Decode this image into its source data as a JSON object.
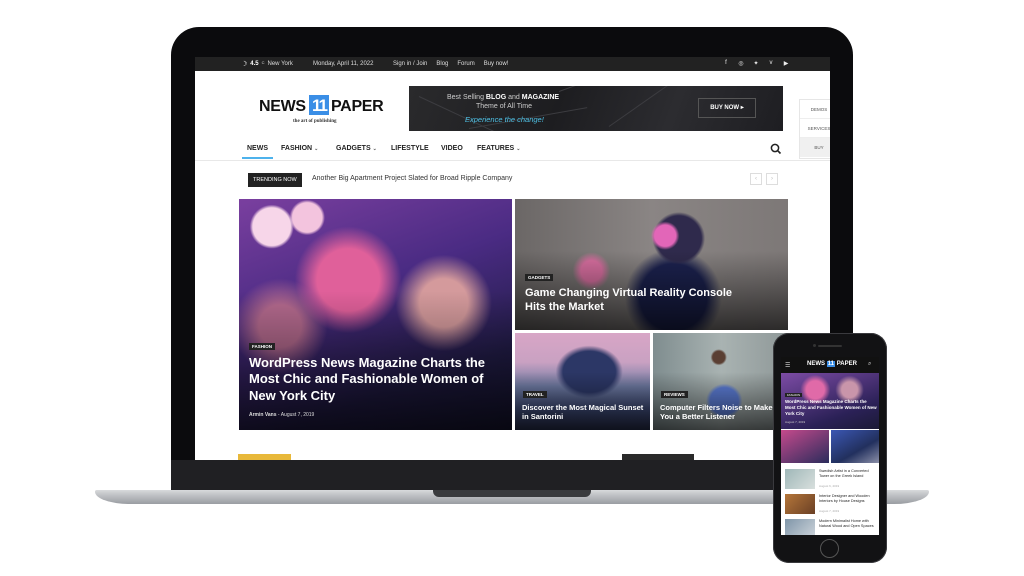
{
  "topbar": {
    "weather_icon": "moon-icon",
    "temperature": "4.5",
    "unit": "C",
    "city": "New York",
    "date": "Monday, April 11, 2022",
    "links": [
      "Sign in / Join",
      "Blog",
      "Forum",
      "Buy now!"
    ],
    "social_icons": [
      "facebook-icon",
      "instagram-icon",
      "twitter-icon",
      "vimeo-icon",
      "youtube-icon"
    ]
  },
  "logo": {
    "word1": "NEWS",
    "number": "11",
    "word2": "PAPER",
    "tagline": "the art of publishing"
  },
  "ad_banner": {
    "line1_pre": "Best Selling ",
    "line1_bold1": "BLOG",
    "line1_mid": " and ",
    "line1_bold2": "MAGAZINE",
    "line2": "Theme of All Time",
    "line3": "Experience the change!",
    "button": "BUY NOW ▸"
  },
  "side_panel": [
    "DEMOS",
    "SERVICES",
    "BUY"
  ],
  "nav": {
    "items": [
      {
        "label": "NEWS",
        "active": true,
        "dropdown": false
      },
      {
        "label": "FASHION",
        "active": false,
        "dropdown": true
      },
      {
        "label": "GADGETS",
        "active": false,
        "dropdown": true
      },
      {
        "label": "LIFESTYLE",
        "active": false,
        "dropdown": false
      },
      {
        "label": "VIDEO",
        "active": false,
        "dropdown": false
      },
      {
        "label": "FEATURES",
        "active": false,
        "dropdown": true
      }
    ],
    "search_icon": "search-icon"
  },
  "trending": {
    "label": "TRENDING NOW",
    "headline": "Another Big Apartment Project Slated for Broad Ripple Company",
    "prev": "‹",
    "next": "›"
  },
  "featured": {
    "main": {
      "category": "FASHION",
      "title": "WordPress News Magazine Charts the Most Chic and Fashionable Women of New York City",
      "author": "Armin Vans",
      "separator": "-",
      "date": "August 7, 2019"
    },
    "top_right": {
      "category": "GADGETS",
      "title": "Game Changing Virtual Reality Console Hits the Market"
    },
    "bottom_left": {
      "category": "TRAVEL",
      "title": "Discover the Most Magical Sunset in Santorini"
    },
    "bottom_right": {
      "category": "REVIEWS",
      "title": "Computer Filters Noise to Make You a Better Listener"
    }
  },
  "accent_colors": {
    "nav_underline": "#4db2ec",
    "logo_number": "#3a8ee6",
    "ad_link": "#4fc3e8",
    "bottom_accent": "#e8b83a"
  },
  "phone": {
    "logo": "NEWS 11 PAPER",
    "hero_category": "FASHION",
    "hero_title": "WordPress News Magazine Charts the Most Chic and Fashionable Women of New York City",
    "hero_date": "August 7, 2019",
    "list": [
      {
        "title": "Swedish Artist in a Converted Tower on the Greek Island",
        "date": "August 6, 2019"
      },
      {
        "title": "Interior Designer and Wooden Interiors by House Designs",
        "date": "August 7, 2019"
      },
      {
        "title": "Modern Minimalist Home with Natural Wood and Open Spaces",
        "date": ""
      }
    ]
  }
}
